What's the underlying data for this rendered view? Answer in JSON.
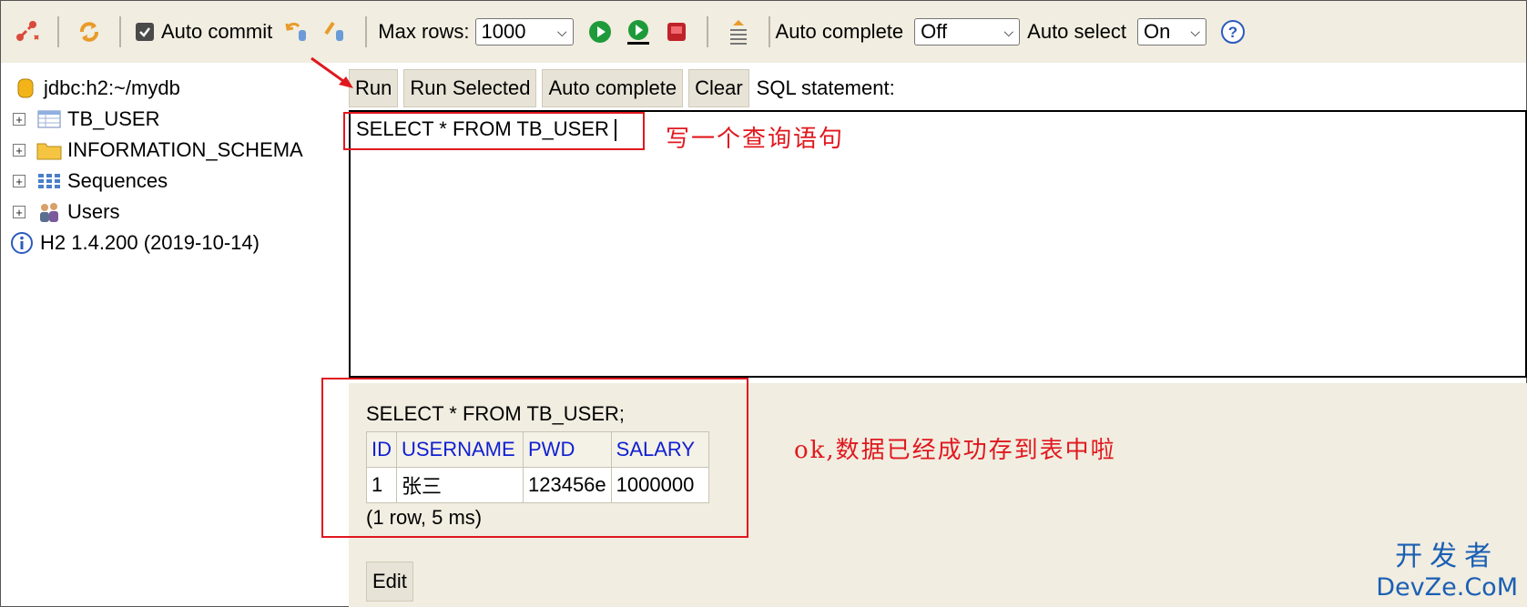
{
  "toolbar": {
    "auto_commit_label": "Auto commit",
    "max_rows_label": "Max rows:",
    "max_rows_value": "1000",
    "auto_complete_label": "Auto complete",
    "auto_complete_value": "Off",
    "auto_select_label": "Auto select",
    "auto_select_value": "On"
  },
  "tree": {
    "connection": "jdbc:h2:~/mydb",
    "items": [
      {
        "label": "TB_USER",
        "icon": "table-icon"
      },
      {
        "label": "INFORMATION_SCHEMA",
        "icon": "folder-icon"
      },
      {
        "label": "Sequences",
        "icon": "sequences-icon"
      },
      {
        "label": "Users",
        "icon": "users-icon"
      }
    ],
    "version": "H2 1.4.200 (2019-10-14)"
  },
  "buttons": {
    "run": "Run",
    "run_selected": "Run Selected",
    "auto_complete": "Auto complete",
    "clear": "Clear",
    "sql_statement_label": "SQL statement:"
  },
  "editor": {
    "value": "SELECT * FROM TB_USER"
  },
  "result": {
    "sql": "SELECT * FROM TB_USER;",
    "columns": [
      "ID",
      "USERNAME",
      "PWD",
      "SALARY"
    ],
    "rows": [
      [
        "1",
        "张三",
        "123456e",
        "1000000"
      ]
    ],
    "info": "(1 row, 5 ms)",
    "edit_label": "Edit"
  },
  "annotations": {
    "query_note": "写一个查询语句",
    "result_note": "ok,数据已经成功存到表中啦",
    "color": "#e0181e"
  },
  "watermark": {
    "cn": "开发者",
    "en": "DevZe.CoM"
  }
}
